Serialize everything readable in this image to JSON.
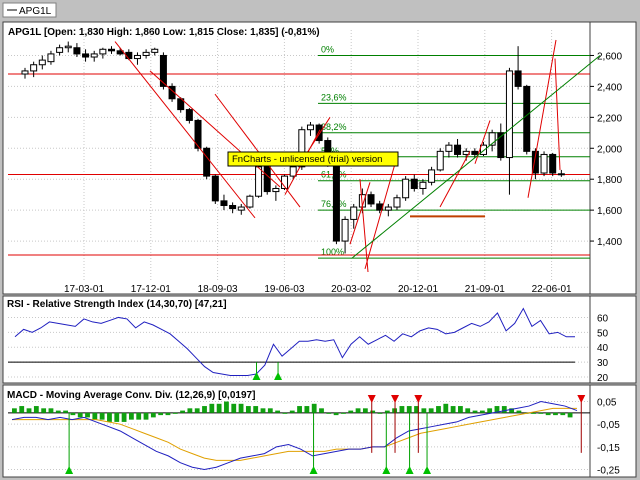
{
  "tab": {
    "label": "APG1L"
  },
  "colors": {
    "background": "#c0c0c0",
    "panel": "#ffffff",
    "grid": "#c8c8c8",
    "candle_up": "#ffffff",
    "candle_down": "#000000",
    "trend": "#e00000",
    "fib": "#008000",
    "rsi": "#2020c0",
    "macd": "#2020c0",
    "signal": "#e0a000",
    "histogram": "#10a010",
    "signal_up": "#00c000",
    "signal_down": "#e00000",
    "banner_bg": "#ffff00"
  },
  "watermark": "FnCharts - unlicensed (trial) version",
  "chart_data": [
    {
      "type": "candlestick",
      "title": "APG1L [Open: 1,830  High: 1,860  Low: 1,815  Close: 1,835] (-0,81%)",
      "ylim": [
        1200,
        2700
      ],
      "yticks": [
        {
          "value": 1400,
          "label": "1,400"
        },
        {
          "value": 1600,
          "label": "1,600"
        },
        {
          "value": 1800,
          "label": "1,800"
        },
        {
          "value": 2000,
          "label": "2,000"
        },
        {
          "value": 2200,
          "label": "2,200"
        },
        {
          "value": 2400,
          "label": "2,400"
        },
        {
          "value": 2600,
          "label": "2,600"
        }
      ],
      "xticks": [
        "17-03-01",
        "17-12-01",
        "18-09-03",
        "19-06-03",
        "20-03-02",
        "20-12-01",
        "21-09-01",
        "22-06-01"
      ],
      "candles": [
        [
          2480,
          2520,
          2450,
          2500
        ],
        [
          2500,
          2560,
          2460,
          2540
        ],
        [
          2540,
          2600,
          2510,
          2570
        ],
        [
          2560,
          2630,
          2540,
          2610
        ],
        [
          2620,
          2670,
          2600,
          2650
        ],
        [
          2650,
          2690,
          2620,
          2660
        ],
        [
          2650,
          2680,
          2590,
          2610
        ],
        [
          2610,
          2640,
          2560,
          2590
        ],
        [
          2590,
          2630,
          2560,
          2610
        ],
        [
          2610,
          2650,
          2580,
          2640
        ],
        [
          2640,
          2660,
          2610,
          2630
        ],
        [
          2630,
          2650,
          2600,
          2610
        ],
        [
          2620,
          2640,
          2570,
          2580
        ],
        [
          2580,
          2620,
          2540,
          2600
        ],
        [
          2600,
          2640,
          2580,
          2620
        ],
        [
          2620,
          2650,
          2600,
          2640
        ],
        [
          2600,
          2620,
          2380,
          2400
        ],
        [
          2400,
          2420,
          2300,
          2320
        ],
        [
          2320,
          2330,
          2230,
          2250
        ],
        [
          2250,
          2260,
          2160,
          2180
        ],
        [
          2180,
          2190,
          1980,
          2000
        ],
        [
          2000,
          2010,
          1800,
          1820
        ],
        [
          1820,
          1830,
          1640,
          1660
        ],
        [
          1660,
          1700,
          1600,
          1630
        ],
        [
          1630,
          1650,
          1580,
          1610
        ],
        [
          1600,
          1640,
          1570,
          1620
        ],
        [
          1620,
          1700,
          1610,
          1690
        ],
        [
          1690,
          1900,
          1680,
          1880
        ],
        [
          1880,
          1890,
          1700,
          1720
        ],
        [
          1720,
          1760,
          1660,
          1740
        ],
        [
          1740,
          1830,
          1730,
          1820
        ],
        [
          1820,
          1900,
          1800,
          1880
        ],
        [
          1880,
          2140,
          1860,
          2120
        ],
        [
          2120,
          2170,
          2080,
          2150
        ],
        [
          2150,
          2160,
          2030,
          2050
        ],
        [
          2050,
          2070,
          1880,
          1900
        ],
        [
          1900,
          1960,
          1380,
          1400
        ],
        [
          1400,
          1560,
          1320,
          1540
        ],
        [
          1540,
          1640,
          1480,
          1620
        ],
        [
          1620,
          1740,
          1580,
          1700
        ],
        [
          1700,
          1720,
          1620,
          1640
        ],
        [
          1640,
          1660,
          1580,
          1600
        ],
        [
          1600,
          1640,
          1560,
          1620
        ],
        [
          1620,
          1700,
          1600,
          1680
        ],
        [
          1680,
          1820,
          1660,
          1800
        ],
        [
          1800,
          1830,
          1720,
          1740
        ],
        [
          1740,
          1800,
          1700,
          1780
        ],
        [
          1780,
          1880,
          1760,
          1860
        ],
        [
          1860,
          2000,
          1850,
          1980
        ],
        [
          1980,
          2040,
          1940,
          2020
        ],
        [
          2020,
          2060,
          1940,
          1960
        ],
        [
          1960,
          2000,
          1920,
          1980
        ],
        [
          1980,
          2000,
          1940,
          1960
        ],
        [
          1960,
          2040,
          1950,
          2020
        ],
        [
          2020,
          2120,
          1980,
          2100
        ],
        [
          2100,
          2160,
          1920,
          1940
        ],
        [
          1940,
          2520,
          1700,
          2500
        ],
        [
          2500,
          2660,
          2380,
          2400
        ],
        [
          2400,
          2410,
          1960,
          1980
        ],
        [
          1980,
          2000,
          1800,
          1840
        ],
        [
          1840,
          1980,
          1820,
          1960
        ],
        [
          1960,
          1970,
          1820,
          1840
        ],
        [
          1830,
          1860,
          1815,
          1835
        ]
      ],
      "fibonacci": [
        {
          "label": "0%",
          "value": 2600
        },
        {
          "label": "23,6%",
          "value": 2290
        },
        {
          "label": "38,2%",
          "value": 2100
        },
        {
          "label": "50%",
          "value": 1945
        },
        {
          "label": "61,8%",
          "value": 1790
        },
        {
          "label": "76,4%",
          "value": 1600
        },
        {
          "label": "100%",
          "value": 1290
        }
      ],
      "resistance": [
        2480,
        1830,
        1310
      ],
      "support_short": 1560
    },
    {
      "type": "line",
      "title": "RSI - Relative Strength Index (14,30,70) [47,21]",
      "ylim": [
        18,
        65
      ],
      "yticks": [
        {
          "value": 20,
          "label": "20"
        },
        {
          "value": 30,
          "label": "30"
        },
        {
          "value": 40,
          "label": "40"
        },
        {
          "value": 50,
          "label": "50"
        },
        {
          "value": 60,
          "label": "60"
        }
      ],
      "reference_line": 30,
      "series": [
        {
          "values": [
            47,
            52,
            50,
            53,
            57,
            56,
            55,
            54,
            59,
            57,
            56,
            58,
            60,
            59,
            53,
            57,
            55,
            52,
            49,
            44,
            39,
            33,
            27,
            23,
            22,
            21,
            21,
            21,
            22,
            28,
            42,
            34,
            39,
            44,
            44,
            45,
            44,
            45,
            33,
            42,
            47,
            42,
            45,
            48,
            44,
            49,
            47,
            51,
            53,
            52,
            49,
            50,
            53,
            56,
            54,
            57,
            63,
            51,
            56,
            66,
            54,
            58,
            49,
            50,
            47,
            47
          ]
        }
      ],
      "signals": [
        {
          "x": 0.427,
          "dir": "up"
        },
        {
          "x": 0.464,
          "dir": "up"
        }
      ]
    },
    {
      "type": "line",
      "title": "MACD - Moving Average Conv. Div. (12,26,9) [0,0197]",
      "ylim": [
        -0.27,
        0.07
      ],
      "yticks": [
        {
          "value": 0.05,
          "label": "0,05"
        },
        {
          "value": -0.05,
          "label": "-0,05"
        },
        {
          "value": -0.15,
          "label": "-0,15"
        },
        {
          "value": -0.25,
          "label": "-0,25"
        }
      ],
      "series": [
        {
          "values": [
            -0.03,
            -0.02,
            -0.02,
            -0.03,
            -0.02,
            -0.03,
            -0.02,
            -0.04,
            -0.06,
            -0.08,
            -0.11,
            -0.14,
            -0.17,
            -0.19,
            -0.22,
            -0.24,
            -0.25,
            -0.24,
            -0.22,
            -0.2,
            -0.19,
            -0.18,
            -0.15,
            -0.14,
            -0.16,
            -0.19,
            -0.18,
            -0.17,
            -0.16,
            -0.16,
            -0.15,
            -0.15,
            -0.11,
            -0.08,
            -0.07,
            -0.06,
            -0.05,
            -0.04,
            -0.02,
            -0.01,
            0.0,
            0.01,
            0.02,
            0.03,
            0.05,
            0.04,
            0.03,
            0.01
          ]
        },
        {
          "values": [
            -0.03,
            -0.03,
            -0.03,
            -0.03,
            -0.03,
            -0.03,
            -0.03,
            -0.03,
            -0.04,
            -0.05,
            -0.07,
            -0.09,
            -0.11,
            -0.13,
            -0.16,
            -0.18,
            -0.2,
            -0.21,
            -0.21,
            -0.21,
            -0.2,
            -0.19,
            -0.18,
            -0.17,
            -0.17,
            -0.17,
            -0.17,
            -0.16,
            -0.16,
            -0.16,
            -0.15,
            -0.15,
            -0.13,
            -0.11,
            -0.09,
            -0.08,
            -0.07,
            -0.06,
            -0.05,
            -0.04,
            -0.03,
            -0.02,
            -0.01,
            0.0,
            0.01,
            0.02,
            0.02,
            0.02
          ]
        }
      ],
      "histogram": [
        0.02,
        0.03,
        0.02,
        0.03,
        0.02,
        0.02,
        0.01,
        0.01,
        -0.01,
        -0.02,
        -0.02,
        -0.03,
        -0.03,
        -0.04,
        -0.04,
        -0.04,
        -0.03,
        -0.03,
        -0.03,
        -0.02,
        -0.01,
        -0.01,
        0.0,
        0.01,
        0.02,
        0.02,
        0.03,
        0.04,
        0.04,
        0.05,
        0.04,
        0.04,
        0.03,
        0.03,
        0.02,
        0.02,
        0.01,
        0.0,
        0.01,
        0.03,
        0.03,
        0.04,
        0.02,
        0.0,
        -0.01,
        0.0,
        0.01,
        0.02,
        0.02,
        0.01,
        0.0,
        0.01,
        0.02,
        0.03,
        0.03,
        0.03,
        0.02,
        0.02,
        0.03,
        0.04,
        0.03,
        0.03,
        0.02,
        0.01,
        0.01,
        0.02,
        0.03,
        0.03,
        0.02,
        0.01,
        0.0,
        0.0,
        0.0,
        -0.01,
        -0.01,
        -0.01,
        -0.02
      ],
      "signals": [
        {
          "x": 0.105,
          "dir": "up"
        },
        {
          "x": 0.525,
          "dir": "up"
        },
        {
          "x": 0.625,
          "dir": "down"
        },
        {
          "x": 0.65,
          "dir": "up"
        },
        {
          "x": 0.665,
          "dir": "down"
        },
        {
          "x": 0.69,
          "dir": "up"
        },
        {
          "x": 0.705,
          "dir": "down"
        },
        {
          "x": 0.72,
          "dir": "up"
        },
        {
          "x": 0.985,
          "dir": "down"
        }
      ]
    }
  ]
}
